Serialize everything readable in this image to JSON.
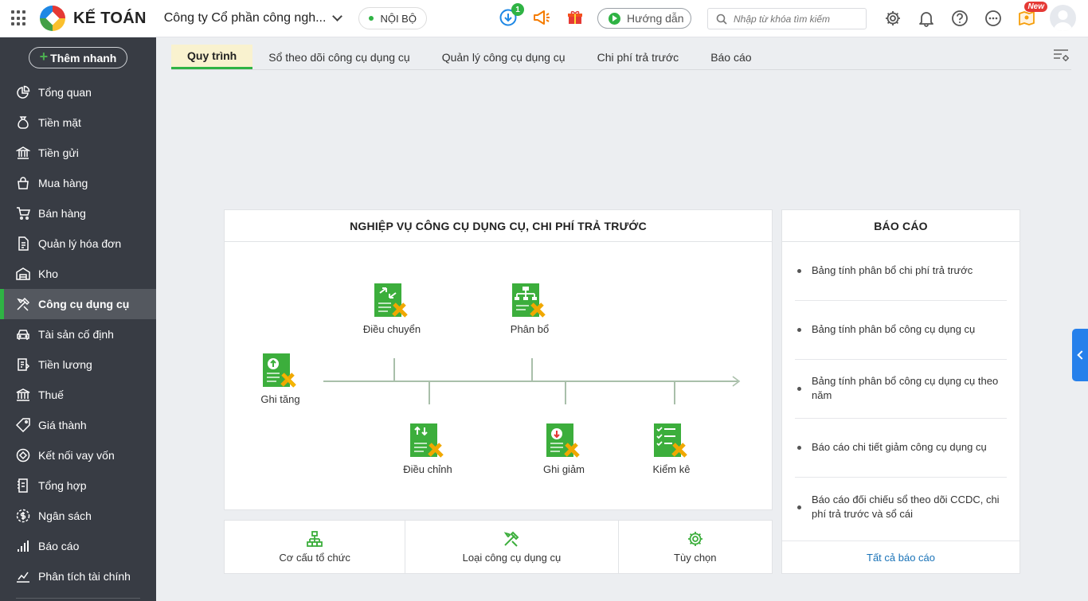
{
  "header": {
    "app_name": "KẾ TOÁN",
    "company": "Công ty Cổ phần công ngh...",
    "scope": "NỘI BỘ",
    "download_badge": "1",
    "guide_label": "Hướng dẫn",
    "search_placeholder": "Nhập từ khóa tìm kiếm",
    "new_badge": "New"
  },
  "sidebar": {
    "quick_add": "Thêm nhanh",
    "items": [
      {
        "label": "Tổng quan",
        "icon": "chart-pie-icon"
      },
      {
        "label": "Tiền mặt",
        "icon": "money-bag-icon"
      },
      {
        "label": "Tiền gửi",
        "icon": "bank-icon"
      },
      {
        "label": "Mua hàng",
        "icon": "shopping-bag-icon"
      },
      {
        "label": "Bán hàng",
        "icon": "cart-icon"
      },
      {
        "label": "Quản lý hóa đơn",
        "icon": "invoice-icon"
      },
      {
        "label": "Kho",
        "icon": "warehouse-icon"
      },
      {
        "label": "Công cụ dụng cụ",
        "icon": "tools-icon"
      },
      {
        "label": "Tài sản cố định",
        "icon": "car-icon"
      },
      {
        "label": "Tiền lương",
        "icon": "payroll-icon"
      },
      {
        "label": "Thuế",
        "icon": "tax-icon"
      },
      {
        "label": "Giá thành",
        "icon": "price-tag-icon"
      },
      {
        "label": "Kết nối vay vốn",
        "icon": "loan-icon"
      },
      {
        "label": "Tổng hợp",
        "icon": "summary-icon"
      },
      {
        "label": "Ngân sách",
        "icon": "budget-icon"
      },
      {
        "label": "Báo cáo",
        "icon": "bar-chart-icon"
      },
      {
        "label": "Phân tích tài chính",
        "icon": "analysis-icon"
      }
    ],
    "active_index": 7
  },
  "tabs": [
    "Quy trình",
    "Sổ theo dõi công cụ dụng cụ",
    "Quản lý công cụ dụng cụ",
    "Chi phí trả trước",
    "Báo cáo"
  ],
  "flow": {
    "title": "NGHIỆP VỤ CÔNG CỤ DỤNG CỤ, CHI PHÍ TRẢ TRƯỚC",
    "nodes": {
      "ghi_tang": "Ghi tăng",
      "dieu_chuyen": "Điều chuyển",
      "phan_bo": "Phân bổ",
      "dieu_chinh": "Điều chỉnh",
      "ghi_giam": "Ghi giảm",
      "kiem_ke": "Kiểm kê"
    }
  },
  "reports": {
    "title": "BÁO CÁO",
    "items": [
      "Bảng tính phân bổ chi phí trả trước",
      "Bảng tính phân bổ công cụ dụng cụ",
      "Bảng tính phân bổ công cụ dụng cụ theo năm",
      "Báo cáo chi tiết giảm công cụ dụng cụ",
      "Báo cáo đối chiếu sổ theo dõi CCDC, chi phí trả trước và sổ cái"
    ],
    "all_link": "Tất cả báo cáo"
  },
  "bottom": {
    "org": "Cơ cấu tổ chức",
    "tool_type": "Loại công cụ dụng cụ",
    "options": "Tùy chọn"
  },
  "colors": {
    "accent": "#2fb344",
    "sidebar": "#383c44",
    "tab_active_bg": "#f9f2cf",
    "link": "#1a73b8"
  }
}
